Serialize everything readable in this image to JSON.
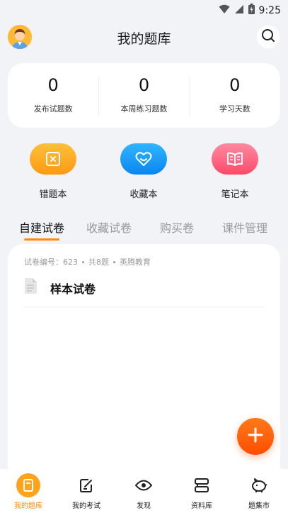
{
  "status_bar": {
    "time": "9:25",
    "icons": [
      "wifi-icon",
      "signal-icon",
      "battery-icon"
    ]
  },
  "header": {
    "title": "我的题库",
    "avatar_icon": "avatar",
    "search_icon": "search-icon"
  },
  "stats": [
    {
      "value": "0",
      "label": "发布试题数"
    },
    {
      "value": "0",
      "label": "本周练习题数"
    },
    {
      "value": "0",
      "label": "学习天数"
    }
  ],
  "shortcuts": [
    {
      "label": "错题本",
      "icon": "wrong-book-icon",
      "color": "#ffa21f"
    },
    {
      "label": "收藏本",
      "icon": "heart-icon",
      "color": "#1c9bff"
    },
    {
      "label": "笔记本",
      "icon": "notebook-icon",
      "color": "#ff5f7c"
    }
  ],
  "tabs": [
    "自建试卷",
    "收藏试卷",
    "购买卷",
    "课件管理"
  ],
  "active_tab": 0,
  "paper": {
    "meta_id": "试卷编号：623",
    "meta_count": "共8题",
    "meta_org": "英腾教育",
    "title": "样本试卷",
    "icon": "document-icon"
  },
  "fab_icon": "plus-icon",
  "accent_color": "#ff8a00",
  "nav": [
    {
      "label": "我的题库",
      "icon": "book-icon"
    },
    {
      "label": "我的考试",
      "icon": "edit-icon"
    },
    {
      "label": "发现",
      "icon": "eye-icon"
    },
    {
      "label": "资料库",
      "icon": "database-icon"
    },
    {
      "label": "题集市",
      "icon": "piggy-bank-icon"
    }
  ]
}
